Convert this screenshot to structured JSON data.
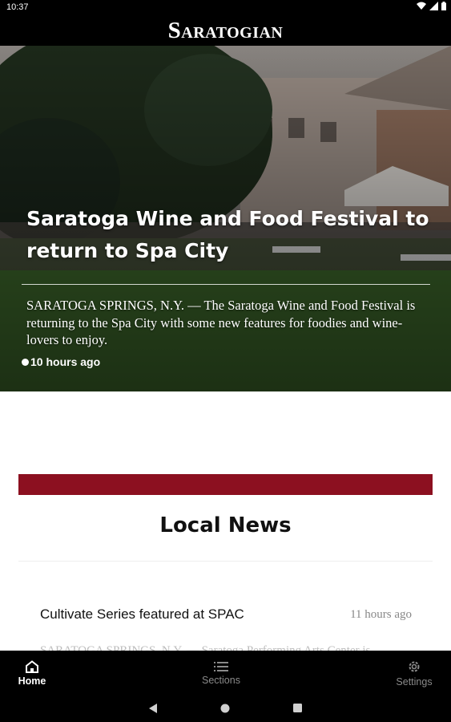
{
  "status_bar": {
    "time": "10:37"
  },
  "header": {
    "logo": "Saratogian"
  },
  "hero": {
    "title": "Saratoga Wine and Food Festival to return to Spa City",
    "summary": "SARATOGA SPRINGS, N.Y. — The Saratoga Wine and Food Festival is returning to the Spa City with some new features for foodies and wine-lovers to enjoy.",
    "time": "10 hours ago"
  },
  "section": {
    "title": "Local News",
    "accent_color": "#8c1020"
  },
  "articles": [
    {
      "title": "Cultivate Series featured at SPAC",
      "time": "11 hours ago",
      "summary_peek": "SARATOGA SPRINGS, N.Y. — Saratoga Performing Arts Center is"
    }
  ],
  "bottom_nav": {
    "items": [
      {
        "label": "Home",
        "icon": "home-icon",
        "active": true
      },
      {
        "label": "Sections",
        "icon": "list-icon",
        "active": false
      },
      {
        "label": "Settings",
        "icon": "gear-icon",
        "active": false
      }
    ]
  },
  "system_nav": {
    "buttons": [
      "back-icon",
      "home-circle-icon",
      "recents-icon"
    ]
  }
}
